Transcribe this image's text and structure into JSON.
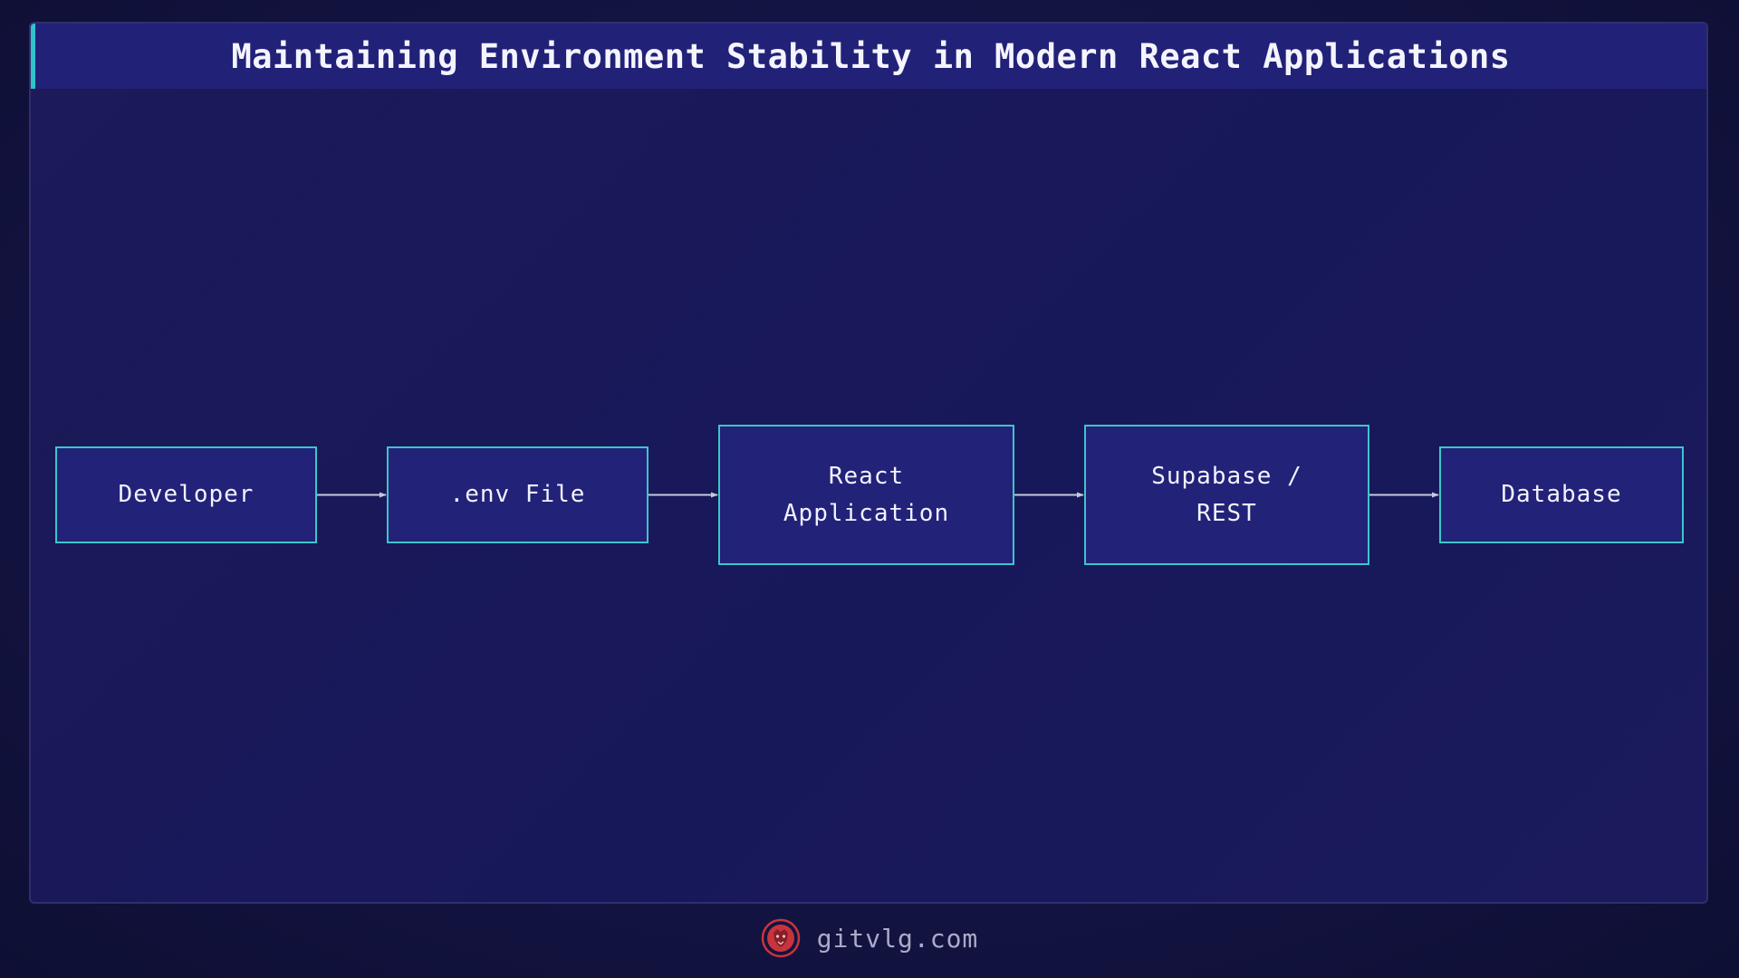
{
  "title": "Maintaining Environment Stability in Modern React Applications",
  "nodes": [
    {
      "id": "developer",
      "label": "Developer"
    },
    {
      "id": "env-file",
      "label": ".env File"
    },
    {
      "id": "react-app",
      "label": "React\nApplication"
    },
    {
      "id": "supabase",
      "label": "Supabase /\nREST"
    },
    {
      "id": "database",
      "label": "Database"
    }
  ],
  "edges": [
    {
      "from": "developer",
      "to": "env-file"
    },
    {
      "from": "env-file",
      "to": "react-app"
    },
    {
      "from": "react-app",
      "to": "supabase"
    },
    {
      "from": "supabase",
      "to": "database"
    }
  ],
  "footer": {
    "site": "gitvlg.com",
    "logo_icon": "lion-head-icon"
  },
  "colors": {
    "background": "#141444",
    "title_bar": "#222178",
    "title_accent": "#2fc3c9",
    "node_fill": "#222278",
    "node_border": "#3cc6c9",
    "edge": "#c8c8dc",
    "logo": "#c8343d"
  }
}
